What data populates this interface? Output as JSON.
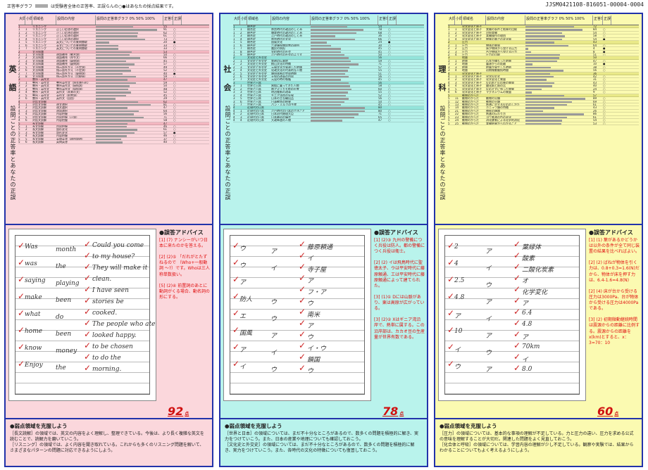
{
  "header": {
    "legend_label": "正答率グラフ",
    "legend_text": "は受験者全体の正答率、正誤らんの○●はあなたの採点結果です。",
    "doc_id": "JJSM0421108-816051-00004-0004"
  },
  "table_header": [
    "大問",
    "小問",
    "領域名",
    "設問の内容",
    "設問の正答率グラフ 0% 50% 100%",
    "正答率(%)",
    "正誤"
  ],
  "panels": [
    {
      "key": "en",
      "title1": "英",
      "title2": "語",
      "subtitle": "設問ごとの正答率とあなたの正誤",
      "rows": [
        {
          "d": "1",
          "s": "",
          "a": "リスニング",
          "c": "",
          "r": 55,
          "m": "",
          "hl": true
        },
        {
          "d": "1",
          "s": "1",
          "a": "リスニング",
          "c": "正しい応答の選択",
          "r": 91,
          "m": "○"
        },
        {
          "d": "1",
          "s": "2",
          "a": "リスニング",
          "c": "正しい応答の選択",
          "r": 62,
          "m": "○"
        },
        {
          "d": "1",
          "s": "3",
          "a": "リスニング",
          "c": "正しい応答の選択",
          "r": 61,
          "m": "○"
        },
        {
          "d": "1",
          "s": "4",
          "a": "リスニング",
          "c": "正しい応答の選択",
          "r": 73,
          "m": "○"
        },
        {
          "d": "1",
          "s": "5",
          "a": "リスニング",
          "c": "英文についての質問聞取",
          "r": 20,
          "m": "●"
        },
        {
          "d": "1",
          "s": "6",
          "a": "リスニング",
          "c": "英文についての質問聞取",
          "r": 33,
          "m": "○"
        },
        {
          "d": "1",
          "s": "7",
          "a": "リスニング",
          "c": "英文についての質問聞取",
          "r": 33,
          "m": "○"
        },
        {
          "d": "2",
          "s": "",
          "a": "文法知識",
          "c": "",
          "r": 53,
          "m": "",
          "hl": true
        },
        {
          "d": "2",
          "s": "1",
          "a": "文法知識",
          "c": "適語補充（動名詞）",
          "r": 50,
          "m": "○"
        },
        {
          "d": "2",
          "s": "2",
          "a": "文法知識",
          "c": "適語補充（命令文）",
          "r": 66,
          "m": "○"
        },
        {
          "d": "2",
          "s": "3",
          "a": "文法知識",
          "c": "適語補充（疑問詞）",
          "r": 45,
          "m": "○"
        },
        {
          "d": "2",
          "s": "4",
          "a": "文法知識",
          "c": "適語補充（疑問詞）",
          "r": 57,
          "m": "○"
        },
        {
          "d": "2",
          "s": "5",
          "a": "文法知識",
          "c": "指示語をかえ（不定詞）",
          "r": 49,
          "m": "○"
        },
        {
          "d": "2",
          "s": "6",
          "a": "文法知識",
          "c": "指示語をかえ（不定詞）",
          "r": 52,
          "m": "○"
        },
        {
          "d": "2",
          "s": "7",
          "a": "文法知識",
          "c": "指示語をかえ（疑問詞）",
          "r": 40,
          "m": "●"
        },
        {
          "d": "2",
          "s": "8",
          "a": "文法知識",
          "c": "指示語をかえ（比較級）",
          "r": 59,
          "m": "○"
        },
        {
          "d": "3",
          "s": "",
          "a": "整序・英作文",
          "c": "",
          "r": 47,
          "m": "",
          "hl": true
        },
        {
          "d": "3",
          "s": "1",
          "a": "整序・英作文",
          "c": "整序英作文（過去進行形）",
          "r": 59,
          "m": "○"
        },
        {
          "d": "3",
          "s": "2",
          "a": "整序・英作文",
          "c": "整序英作文（接続詞）",
          "r": 50,
          "m": "○"
        },
        {
          "d": "3",
          "s": "3",
          "a": "整序・英作文",
          "c": "整序英作文（接続詞）",
          "r": 48,
          "m": "○"
        },
        {
          "d": "3",
          "s": "4",
          "a": "整序・英作文",
          "c": "英作文（未来の文）",
          "r": 52,
          "m": "○"
        },
        {
          "d": "3",
          "s": "5",
          "a": "整序・英作文",
          "c": "英作文（前置詞）",
          "r": 45,
          "m": "○"
        },
        {
          "d": "3",
          "s": "6",
          "a": "整序・英作文",
          "c": "英作文（自由）",
          "r": 29,
          "m": "○"
        },
        {
          "d": "4",
          "s": "",
          "a": "対話文読解",
          "c": "",
          "r": 62,
          "m": "",
          "hl": true
        },
        {
          "d": "4",
          "s": "1",
          "a": "対話文読解",
          "c": "適文選択",
          "r": 81,
          "m": "○"
        },
        {
          "d": "4",
          "s": "2",
          "a": "対話文読解",
          "c": "適文選択",
          "r": 47,
          "m": "○"
        },
        {
          "d": "4",
          "s": "3",
          "a": "対話文読解",
          "c": "適語選択",
          "r": 64,
          "m": "○"
        },
        {
          "d": "4",
          "s": "4",
          "a": "対話文読解",
          "c": "内容把握",
          "r": 56,
          "m": "○"
        },
        {
          "d": "4",
          "s": "5",
          "a": "対話文読解",
          "c": "内容把握（正誤）",
          "r": 71,
          "m": "○"
        },
        {
          "d": "4",
          "s": "6",
          "a": "対話文読解",
          "c": "内容把握",
          "r": 58,
          "m": "○"
        },
        {
          "d": "5",
          "s": "",
          "a": "長文読解",
          "c": "",
          "r": 47,
          "m": "",
          "hl": true
        },
        {
          "d": "5",
          "s": "1",
          "a": "長文読解",
          "c": "内容把握",
          "r": 46,
          "m": "○"
        },
        {
          "d": "5",
          "s": "2",
          "a": "長文読解",
          "c": "語形変化",
          "r": 61,
          "m": "○"
        },
        {
          "d": "5",
          "s": "3",
          "a": "長文読解",
          "c": "語形変化",
          "r": 57,
          "m": "●"
        },
        {
          "d": "5",
          "s": "4",
          "a": "長文読解",
          "c": "内容把握",
          "r": 46,
          "m": "○"
        },
        {
          "d": "5",
          "s": "5",
          "a": "長文読解",
          "c": "英問英答（理由説明）",
          "r": 37,
          "m": "○"
        },
        {
          "d": "5",
          "s": "6",
          "a": "長文読解",
          "c": "英問英答",
          "r": 40,
          "m": "○"
        }
      ],
      "advice_title": "●誤答アドバイス",
      "advice": "[1] (7) ナンシーがいつ日本に来たのかを答える。\n\n[2] (2)⑤ 「だれがとたずねるので （Who+一般動詞 ～?）です。Whoは三人称単数扱い。\n\n[5] (2)④ 前置詞のあとに動詞がくる場合、動名詞の形にする。",
      "score": "92",
      "score_unit": "点",
      "weak_title": "●弱点領域を克服しよう",
      "weak": "［長文読解］の領域では、英文の内容をよく理解し、整理できている。今後は、より長く複雑な英文を読むことで、読解力を磨いていこう。\n［リスニング］の領域では、よく内容を聞き取れている。これからも多くのリスニング問題を解いて、さまざまなパターンの問題に対応できるようにしよう。",
      "hand": [
        [
          "Was",
          "month"
        ],
        [
          "was",
          "the"
        ],
        [
          "saying",
          "playing"
        ],
        [
          "make",
          "been"
        ],
        [
          "what",
          "do"
        ],
        [
          "home",
          "been"
        ],
        [
          "know",
          "money"
        ],
        [
          "Enjoy",
          "the"
        ]
      ],
      "hand2": [
        "Could you come",
        "to my house?",
        "They will make it",
        "clean.",
        "I have seen",
        "stories be",
        "cooked.",
        "The people who ate",
        "looked happy.",
        "to be chosen",
        "to do the",
        "morning."
      ]
    },
    {
      "key": "so",
      "title1": "社",
      "title2": "会",
      "subtitle": "設問ごとの正答率とあなたの正誤",
      "rows": [
        {
          "d": "1",
          "s": "",
          "a": "総合史",
          "c": "",
          "r": 54,
          "m": "",
          "hl": true
        },
        {
          "d": "1",
          "s": "1",
          "a": "総合史",
          "c": "奈良時代の政治のしくみ",
          "r": 78,
          "m": "○"
        },
        {
          "d": "1",
          "s": "2",
          "a": "総合史",
          "c": "鎌倉時代の政治のしくみ",
          "r": 68,
          "m": "○"
        },
        {
          "d": "1",
          "s": "3",
          "a": "総合史",
          "c": "江戸時代の政治のしくみ",
          "r": 36,
          "m": "○"
        },
        {
          "d": "1",
          "s": "4",
          "a": "総合史",
          "c": "奈良時代の文化",
          "r": 66,
          "m": "○"
        },
        {
          "d": "1",
          "s": "5",
          "a": "総合史",
          "c": "国風文化",
          "r": 24,
          "m": "●"
        },
        {
          "d": "1",
          "s": "6",
          "a": "総合史",
          "c": "六波羅探題設置の理由",
          "r": 30,
          "m": "○"
        },
        {
          "d": "1",
          "s": "7",
          "a": "総合史",
          "c": "農民の負担",
          "r": 45,
          "m": "○"
        },
        {
          "d": "1",
          "s": "8",
          "a": "総合史",
          "c": "室町時代の社会",
          "r": 45,
          "m": "○"
        },
        {
          "d": "1",
          "s": "9",
          "a": "総合史",
          "c": "江戸時代の社会のようす",
          "r": 50,
          "m": "○"
        },
        {
          "d": "2",
          "s": "",
          "a": "文化史と外交史",
          "c": "",
          "r": 56,
          "m": "",
          "hl": true
        },
        {
          "d": "2",
          "s": "1",
          "a": "文化史と外交史",
          "c": "鉄砲の伝来地",
          "r": 59,
          "m": "○"
        },
        {
          "d": "2",
          "s": "2",
          "a": "文化史と外交史",
          "c": "桃山文化の特徴",
          "r": 71,
          "m": "○"
        },
        {
          "d": "2",
          "s": "3",
          "a": "文化史と外交史",
          "c": "元禄文化が発達した地域",
          "r": 57,
          "m": "○"
        },
        {
          "d": "2",
          "s": "4",
          "a": "文化史と外交史",
          "c": "化政文化の代表的な人物",
          "r": 55,
          "m": "○"
        },
        {
          "d": "2",
          "s": "5",
          "a": "文化史と外交史",
          "c": "鎖国体制の完成時期",
          "r": 51,
          "m": "○"
        },
        {
          "d": "2",
          "s": "6",
          "a": "文化史と外交史",
          "c": "天保の改革の内容",
          "r": 56,
          "m": "○"
        },
        {
          "d": "2",
          "s": "7",
          "a": "文化史と外交史",
          "c": "元寇の時の執権",
          "r": 45,
          "m": "○"
        },
        {
          "d": "3",
          "s": "",
          "a": "世界と日本",
          "c": "",
          "r": 56,
          "m": "",
          "hl": true
        },
        {
          "d": "3",
          "s": "1",
          "a": "世界と日本",
          "c": "黒船に乗ってきた人物",
          "r": 58,
          "m": "○"
        },
        {
          "d": "3",
          "s": "2",
          "a": "世界と日本",
          "c": "南アメリカ大陸の位置",
          "r": 60,
          "m": "○"
        },
        {
          "d": "3",
          "s": "3",
          "a": "世界と日本",
          "c": "明治維新の改革",
          "r": 55,
          "m": "○"
        },
        {
          "d": "3",
          "s": "4",
          "a": "世界と日本",
          "c": "ギニア湾岸の気候",
          "r": 52,
          "m": "○"
        },
        {
          "d": "3",
          "s": "5",
          "a": "世界と日本",
          "c": "日本の主な輸出品",
          "r": 56,
          "m": "○"
        },
        {
          "d": "3",
          "s": "6",
          "a": "世界と日本",
          "c": "日清戦争の結果",
          "r": 50,
          "m": "○"
        },
        {
          "d": "3",
          "s": "7",
          "a": "世界と日本",
          "c": "パン・ミルクの生産",
          "r": 45,
          "m": "○"
        },
        {
          "d": "4",
          "s": "",
          "a": "近現代の日本",
          "c": "",
          "r": 80,
          "m": "",
          "hl": true
        },
        {
          "d": "4",
          "s": "1",
          "a": "近現代の日本",
          "c": "江戸時代の日本のできごと",
          "r": 80,
          "m": "○"
        },
        {
          "d": "4",
          "s": "2",
          "a": "近現代の日本",
          "c": "日本初代総理大臣",
          "r": 71,
          "m": "○"
        },
        {
          "d": "4",
          "s": "3",
          "a": "近現代の日本",
          "c": "日本最初の議会",
          "r": 65,
          "m": "○"
        },
        {
          "d": "4",
          "s": "4",
          "a": "近現代の日本",
          "c": "大政奉還の人物",
          "r": 47,
          "m": "○"
        }
      ],
      "advice_title": "●誤答アドバイス",
      "advice": "[1] (2)③ 九州の警備につく兵役は防人。都の警備につく兵役は衛士。\n\n[2] (2) イは飛鳥時代に聖徳太子、ウは平安時代に藤原頼通、エは平安時代に藤原頼通によって建てられた。\n\n[3] (1)① Dには山脈があり、東は高原が広がっている。\n\n[3] (2)② Xはギニア湾沿岸で、熱帯に属する。この沿岸部は、カカオ豆の生産量が世界有数である。",
      "score": "78",
      "score_unit": "点",
      "weak_title": "●弱点領域を克服しよう",
      "weak": "［世界と日本］の領域については、まだ不十分なところがあるので、数多くの問題を積極的に解き、実力をつけていこう。また、日本の産業や地理についても確認しておこう。\n［文化史と外交史］の領域については、まだ不十分なところがあるので、数多くの問題を積極的に解き、実力をつけていこう。また、各時代の文化の特徴についても復習しておこう。",
      "hand": [
        [
          "ウ",
          "ア"
        ],
        [
          "ウ",
          "イ"
        ],
        [
          "ア",
          ""
        ],
        [
          "防人",
          "ウ"
        ],
        [
          "エ",
          "ウ"
        ],
        [
          "国風",
          "ア"
        ],
        [
          "ア",
          "イ"
        ],
        [
          "イ",
          "ウ"
        ]
      ],
      "hand2": [
        "藤原頼通",
        "イ",
        "寺子屋",
        "ア",
        "フ・ア",
        "ウ",
        "南米",
        "ア",
        "ウ",
        "イ・ウ",
        "鎖国",
        "ウ"
      ]
    },
    {
      "key": "sc",
      "title1": "理",
      "title2": "科",
      "subtitle": "設問ごとの正答率とあなたの正誤",
      "rows": [
        {
          "d": "1",
          "s": "",
          "a": "化学変化と原子",
          "c": "",
          "r": 72,
          "m": "",
          "hl": true
        },
        {
          "d": "1",
          "s": "1",
          "a": "化学変化と原子",
          "c": "実験の条件と結果の比較",
          "r": 84,
          "m": "○"
        },
        {
          "d": "1",
          "s": "2",
          "a": "化学変化と原子",
          "c": "対照実験",
          "r": 54,
          "m": "○"
        },
        {
          "d": "1",
          "s": "3",
          "a": "化学変化と原子",
          "c": "実験操作の理由",
          "r": 58,
          "m": "○"
        },
        {
          "d": "1",
          "s": "4",
          "a": "化学変化と原子",
          "c": "物質の重さの変化量",
          "r": 54,
          "m": "●"
        },
        {
          "d": "2",
          "s": "",
          "a": "圧力",
          "c": "",
          "r": 43,
          "m": "",
          "hl": true
        },
        {
          "d": "2",
          "s": "1",
          "a": "圧力",
          "c": "物体の質量",
          "r": 64,
          "m": "○"
        },
        {
          "d": "2",
          "s": "2",
          "a": "圧力",
          "c": "床が物体から受ける圧力",
          "r": 4,
          "m": "●"
        },
        {
          "d": "2",
          "s": "3",
          "a": "圧力",
          "c": "台が物体から受ける圧力",
          "r": 8,
          "m": "●"
        },
        {
          "d": "2",
          "s": "4",
          "a": "圧力",
          "c": "圧力の比較",
          "r": 51,
          "m": "○"
        },
        {
          "d": "3",
          "s": "",
          "a": "地層",
          "c": "",
          "r": 50,
          "m": "",
          "hl": true
        },
        {
          "d": "3",
          "s": "1",
          "a": "地層",
          "c": "石灰が積もった地層",
          "r": 47,
          "m": "○"
        },
        {
          "d": "3",
          "s": "2",
          "a": "地層",
          "c": "震源からの距離",
          "r": 10,
          "m": "●"
        },
        {
          "d": "3",
          "s": "3",
          "a": "地層",
          "c": "地震が発生した時刻",
          "r": 38,
          "m": "○"
        },
        {
          "d": "3",
          "s": "4",
          "a": "地層",
          "c": "初期微動継続時間",
          "r": 56,
          "m": "○"
        },
        {
          "d": "4",
          "s": "",
          "a": "化学変化と原子",
          "c": "",
          "r": 36,
          "m": "",
          "hl": true
        },
        {
          "d": "4",
          "s": "1",
          "a": "化学変化と原子",
          "c": "化学反応式",
          "r": 42,
          "m": "○"
        },
        {
          "d": "4",
          "s": "2",
          "a": "化学変化と原子",
          "c": "化学変化と質量",
          "r": 31,
          "m": "○"
        },
        {
          "d": "4",
          "s": "3",
          "a": "化学変化と原子",
          "c": "反応前と反応後の質量",
          "r": 43,
          "m": "○"
        },
        {
          "d": "4",
          "s": "4",
          "a": "化学変化と原子",
          "c": "酸化銅と銅の比",
          "r": 40,
          "m": "○"
        },
        {
          "d": "4",
          "s": "5",
          "a": "化学変化と原子",
          "c": "反応せずに残った物質",
          "r": 24,
          "m": "○"
        },
        {
          "d": "4",
          "s": "6",
          "a": "化学変化と原子",
          "c": "マグネシウムの質量",
          "r": 9,
          "m": "○"
        },
        {
          "d": "5",
          "s": "",
          "a": "動物のからだ",
          "c": "",
          "r": 57,
          "m": "",
          "hl": true
        },
        {
          "d": "5",
          "s": "11",
          "a": "動物のからだ",
          "c": "動物の分類",
          "r": 89,
          "m": "○"
        },
        {
          "d": "5",
          "s": "12",
          "a": "動物のからだ",
          "c": "動物の分類",
          "r": 69,
          "m": "○"
        },
        {
          "d": "5",
          "s": "13",
          "a": "動物のからだ",
          "c": "刺激に対する反応のしかた",
          "r": 61,
          "m": "○"
        },
        {
          "d": "5",
          "s": "14",
          "a": "動物のからだ",
          "c": "ホニュウ類の特徴",
          "r": 43,
          "m": "○"
        },
        {
          "d": "5",
          "s": "21",
          "a": "動物のからだ",
          "c": "神経の順路",
          "r": 26,
          "m": "○"
        },
        {
          "d": "5",
          "s": "22",
          "a": "動物のからだ",
          "c": "刺激の伝わり方",
          "r": 86,
          "m": "○"
        },
        {
          "d": "5",
          "s": "23",
          "a": "動物のからだ",
          "c": "ヨウ素液の色の変化",
          "r": 61,
          "m": "○"
        },
        {
          "d": "5",
          "s": "24",
          "a": "動物のからだ",
          "c": "消化酵素による化学的消化",
          "r": 54,
          "m": "○"
        },
        {
          "d": "5",
          "s": "25",
          "a": "動物のからだ",
          "c": "実験結果からわかること",
          "r": 53,
          "m": "○"
        }
      ],
      "advice_title": "●誤答アドバイス",
      "advice": "[1] (1) 葉があるかどうかは以外の条件が全て同じ装置の結果を比べればよい。\n\n[2] (2) ばねが物体を引く力は、0.8+0.3=1.6(N)だから、物体が床を押す力は、6.4-1.6=4.8(N)\n\n[2] (4) 床が台から受ける圧力は3000Pa、台が物体から受ける圧力は4000Paである。\n\n[3] (2) 初期微動継続時間は震源からの距離に比例する。震源からの距離をx(km)とすると、x：3=70：10",
      "score": "60",
      "score_unit": "点",
      "weak_title": "●弱点領域を克服しよう",
      "weak": "［圧力］の領域については、基本的な事項の理解が不足している。力と圧力の違い、圧力を求める公式の意味を理解することが大切だ。関連した問題をよく見直しておこう。\n［化合体と呼吸］の領域については、学習内容の理解が少し不足している。観察や実験では、結果からわかることについてもよく考えるようにしよう。",
      "hand": [
        [
          "2",
          "ア"
        ],
        [
          "4",
          "イ"
        ],
        [
          "2.5",
          "ウ"
        ],
        [
          "4.8",
          "ア"
        ],
        [
          "ア",
          "イ"
        ],
        [
          "10",
          "ア"
        ],
        [
          "イ",
          "ウ"
        ],
        [
          "ウ",
          "ア"
        ]
      ],
      "hand2": [
        "葉緑体",
        "酸素",
        "二酸化炭素",
        "オ",
        "化学変化",
        "ア",
        "6.4",
        "4.8",
        "ア",
        "70km",
        "イ",
        "8.0"
      ]
    }
  ]
}
